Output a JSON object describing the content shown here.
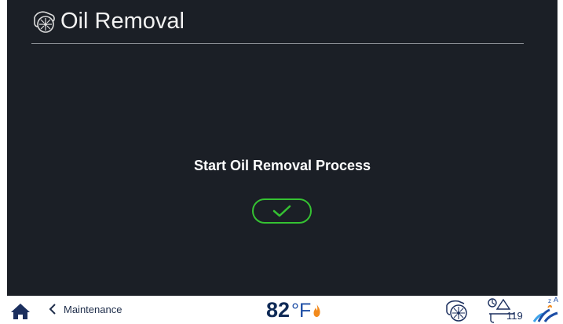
{
  "header": {
    "title": "Oil Removal",
    "icon": "fryer-vat-icon"
  },
  "main": {
    "prompt": "Start Oil Removal Process",
    "confirm_icon": "checkmark-icon"
  },
  "footer": {
    "home_icon": "home-icon",
    "back_label": "Maintenance",
    "temperature": {
      "value": "82",
      "unit": "°F"
    },
    "status": {
      "fill_level_number": "119"
    },
    "colors": {
      "accent_green": "#35c232",
      "flame_orange": "#f28a1c",
      "navy": "#0f2a56"
    }
  }
}
